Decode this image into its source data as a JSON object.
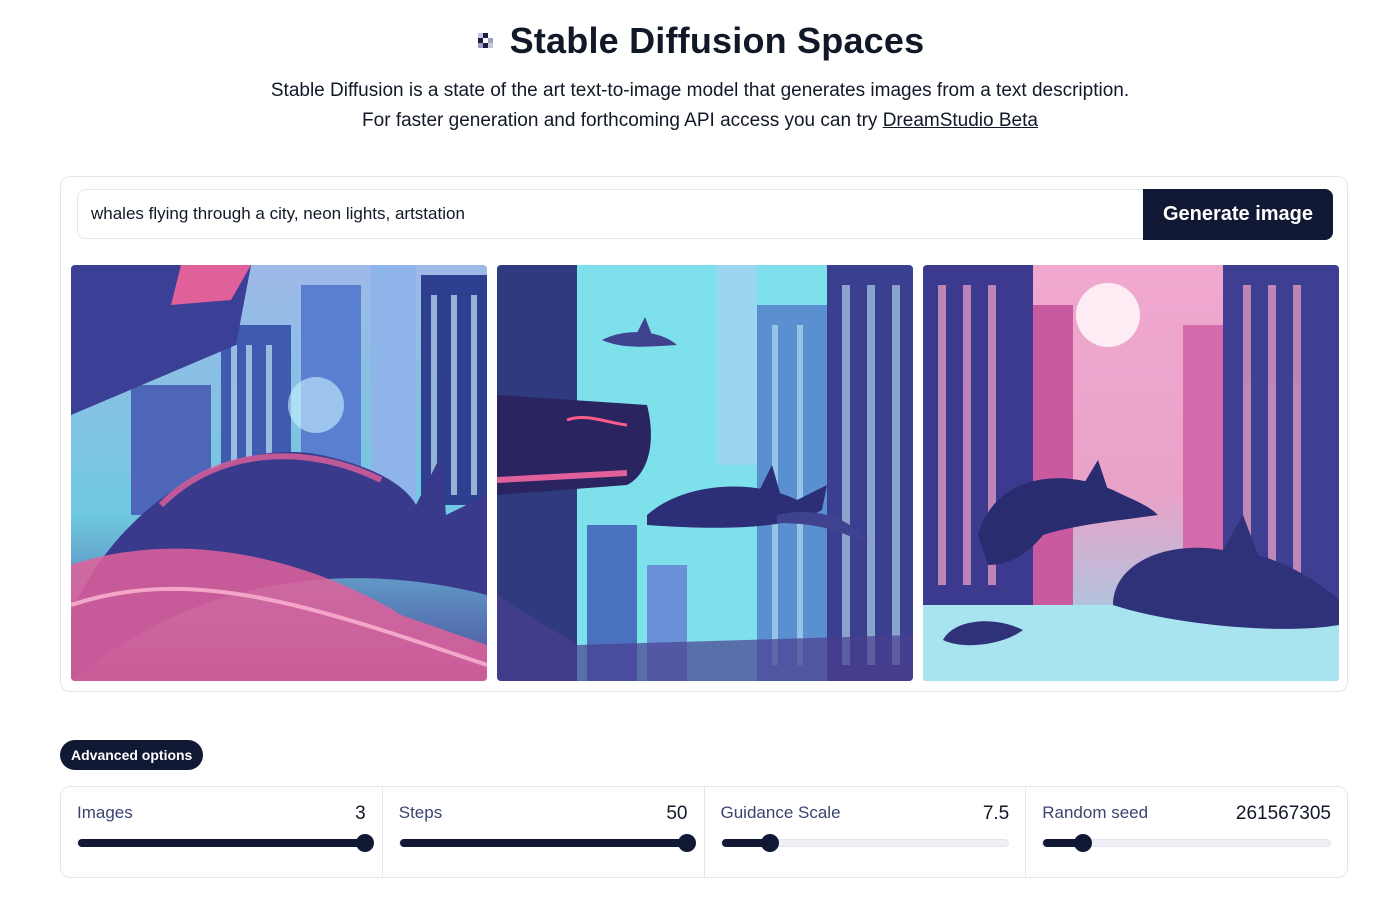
{
  "header": {
    "title": "Stable Diffusion Spaces",
    "description_line1": "Stable Diffusion is a state of the art text-to-image model that generates images from a text description.",
    "description_line2_prefix": "For faster generation and forthcoming API access you can try",
    "dreamstudio_link": "DreamStudio Beta"
  },
  "prompt": {
    "value": "whales flying through a city, neon lights, artstation"
  },
  "generate_button": "Generate image",
  "advanced_options_button": "Advanced options",
  "options": [
    {
      "label": "Images",
      "value": "3",
      "fraction": 1.0
    },
    {
      "label": "Steps",
      "value": "50",
      "fraction": 1.0
    },
    {
      "label": "Guidance Scale",
      "value": "7.5",
      "fraction": 0.17
    },
    {
      "label": "Random seed",
      "value": "261567305",
      "fraction": 0.14
    }
  ],
  "colors": {
    "accent": "#111833",
    "neon_pink": "#e0609a",
    "neon_cyan": "#7ee0ea",
    "indigo": "#3b3a8f"
  }
}
